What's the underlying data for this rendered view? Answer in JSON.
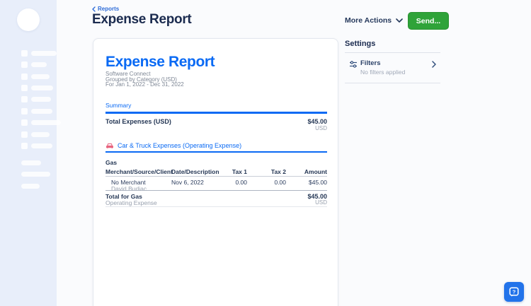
{
  "header": {
    "breadcrumb": "Reports",
    "title": "Expense Report",
    "more_actions": "More Actions",
    "send": "Send..."
  },
  "report": {
    "title": "Expense Report",
    "company": "Software Connect",
    "grouping": "Grouped by Category (USD)",
    "period": "For Jan 1, 2022 - Dec 31, 2022",
    "summary_heading": "Summary",
    "summary_total_label": "Total Expenses (USD)",
    "summary_total_amount": "$45.00",
    "summary_total_currency": "USD",
    "category_heading": "Car & Truck Expenses (Operating Expense)",
    "subcategory": "Gas",
    "table": {
      "columns": [
        "Merchant/Source/Client",
        "Date/Description",
        "Tax 1",
        "Tax 2",
        "Amount"
      ],
      "rows": [
        {
          "merchant": "No Merchant",
          "client": "David Budiac",
          "date": "Nov 6, 2022",
          "tax1": "0.00",
          "tax2": "0.00",
          "amount": "$45.00"
        }
      ],
      "total_label": "Total for Gas",
      "total_sublabel": "Operating Expense",
      "total_amount": "$45.00",
      "total_currency": "USD"
    }
  },
  "settings": {
    "heading": "Settings",
    "filters_label": "Filters",
    "filters_status": "No filters applied"
  },
  "colors": {
    "accent_blue": "#0a6af4",
    "navy": "#1b2b4f",
    "send_green": "#2fa339",
    "sidebar_bg": "#e8eefa",
    "car_icon_pink": "#e8647f",
    "help_button_blue": "#2273ea"
  }
}
